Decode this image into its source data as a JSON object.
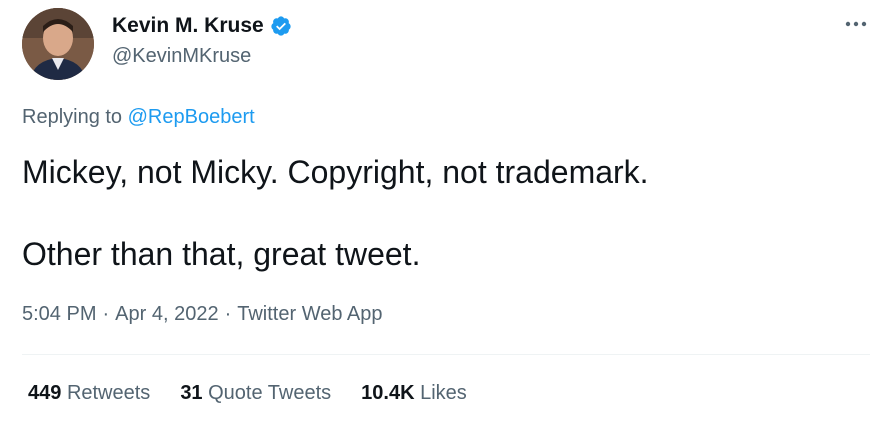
{
  "author": {
    "display_name": "Kevin M. Kruse",
    "handle": "@KevinMKruse",
    "verified_icon": "verified-badge-icon"
  },
  "reply": {
    "prefix": "Replying to",
    "target": "@RepBoebert"
  },
  "tweet": {
    "line1": "Mickey, not Micky. Copyright, not trademark.",
    "line2": "Other than that, great tweet."
  },
  "meta": {
    "time": "5:04 PM",
    "separator": "·",
    "date": "Apr 4, 2022",
    "source": "Twitter Web App"
  },
  "stats": {
    "retweets_count": "449",
    "retweets_label": "Retweets",
    "quotes_count": "31",
    "quotes_label": "Quote Tweets",
    "likes_count": "10.4K",
    "likes_label": "Likes"
  },
  "colors": {
    "text": "#0f1419",
    "secondary": "#536471",
    "accent": "#1d9bf0",
    "divider": "#eff3f4"
  }
}
